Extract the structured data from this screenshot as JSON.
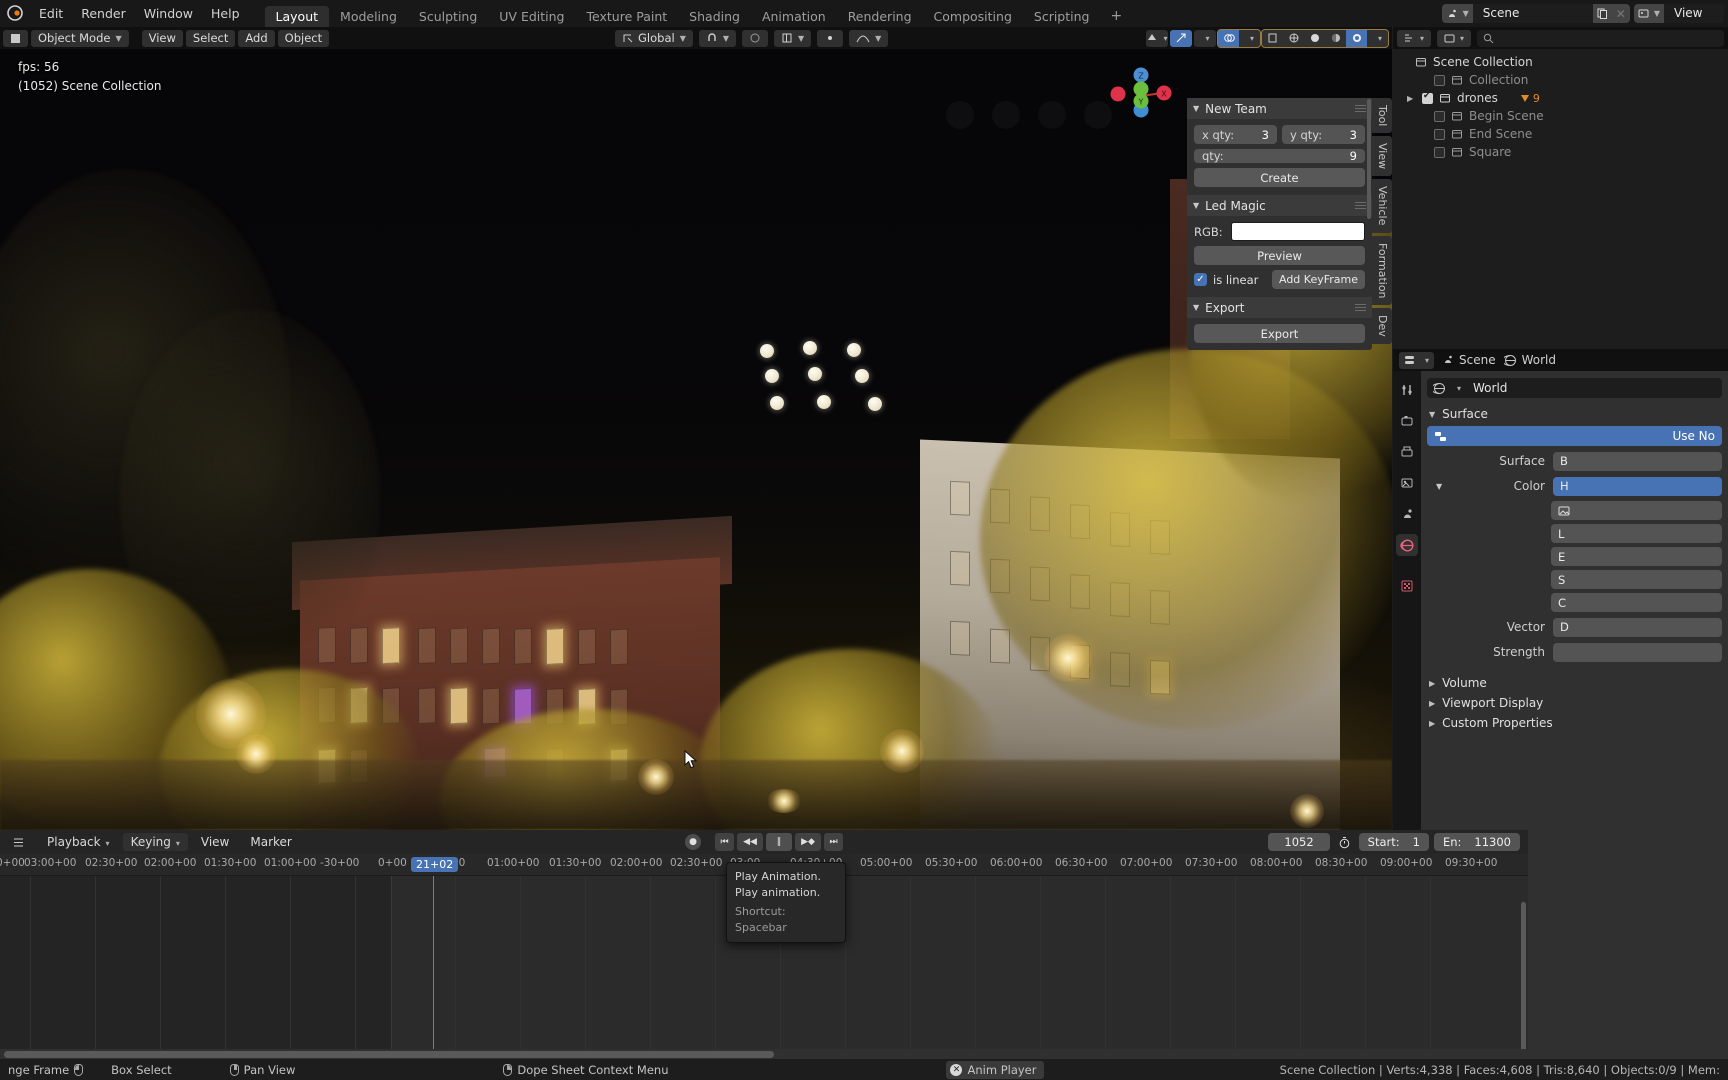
{
  "app": {
    "title": "Blender",
    "menus": [
      "Edit",
      "Render",
      "Window",
      "Help"
    ],
    "workspaces": [
      {
        "label": "Layout",
        "active": true
      },
      {
        "label": "Modeling",
        "active": false
      },
      {
        "label": "Sculpting",
        "active": false
      },
      {
        "label": "UV Editing",
        "active": false
      },
      {
        "label": "Texture Paint",
        "active": false
      },
      {
        "label": "Shading",
        "active": false
      },
      {
        "label": "Animation",
        "active": false
      },
      {
        "label": "Rendering",
        "active": false
      },
      {
        "label": "Compositing",
        "active": false
      },
      {
        "label": "Scripting",
        "active": false
      }
    ],
    "add_workspace_label": "+",
    "scene_name": "Scene",
    "view_layer_name": "View",
    "scene_icon": "scene-icon",
    "viewlayer_icon": "view-layer-icon",
    "new_scene_icon": "duplicate-icon",
    "remove_scene_icon": "close-icon"
  },
  "viewport_header": {
    "mode": "Object Mode",
    "menus": [
      "View",
      "Select",
      "Add",
      "Object"
    ],
    "transform_orientation": "Global",
    "snap_icon": "magnet-icon",
    "proportional_icon": "proportional-edit-icon",
    "falloff_icon": "falloff-curve-icon",
    "pivot_icon": "pivot-point-icon",
    "gizmo_icon": "gizmo-icon",
    "overlays_icon": "overlays-icon",
    "xray_icon": "xray-icon",
    "shading_wireframe_icon": "wireframe-icon",
    "shading_solid_icon": "solid-icon",
    "shading_material_icon": "material-preview-icon",
    "shading_rendered_icon": "rendered-icon"
  },
  "viewport": {
    "fps_text": "fps: 56",
    "collection_text": "(1052) Scene Collection",
    "gizmo_axes": [
      "Z",
      "Y",
      "X"
    ],
    "drone_count": 9,
    "drone_grid": {
      "cols": 3,
      "rows": 3
    }
  },
  "npanel": {
    "tabs": [
      "Tool",
      "View",
      "Vehicle",
      "Formation",
      "Dev"
    ],
    "active_tab": "Formation",
    "sections": [
      {
        "title": "New Team",
        "fields": [
          {
            "label": "x qty:",
            "value": "3"
          },
          {
            "label": "y qty:",
            "value": "3"
          },
          {
            "label": "qty:",
            "value": "9"
          }
        ],
        "button": "Create"
      },
      {
        "title": "Led Magic",
        "rgb_label": "RGB:",
        "rgb_color": "#ffffff",
        "preview_button": "Preview",
        "checkbox_label": "is linear",
        "checkbox_checked": true,
        "keyframe_button": "Add KeyFrame"
      },
      {
        "title": "Export",
        "button": "Export"
      }
    ]
  },
  "outliner": {
    "display_mode_icon": "outliner-display-mode-icon",
    "filter_icon": "filter-icon",
    "search_icon": "search-icon",
    "search_placeholder": "",
    "root": "Scene Collection",
    "items": [
      {
        "label": "Collection",
        "icon": "collection-icon",
        "checked": false,
        "dim": true,
        "expandable": false,
        "badge": ""
      },
      {
        "label": "drones",
        "icon": "collection-icon",
        "checked": true,
        "dim": false,
        "expandable": true,
        "badge": "9"
      },
      {
        "label": "Begin Scene",
        "icon": "collection-icon",
        "checked": false,
        "dim": true,
        "expandable": false,
        "badge": ""
      },
      {
        "label": "End Scene",
        "icon": "collection-icon",
        "checked": false,
        "dim": true,
        "expandable": false,
        "badge": ""
      },
      {
        "label": "Square",
        "icon": "collection-icon",
        "checked": false,
        "dim": true,
        "expandable": false,
        "badge": ""
      }
    ]
  },
  "properties": {
    "editor_icon": "properties-editor-icon",
    "breadcrumb": [
      {
        "label": "Scene",
        "icon": "scene-icon"
      },
      {
        "label": "World",
        "icon": "world-icon"
      }
    ],
    "tabs": [
      {
        "name": "tool-tab",
        "glyph": "⚙",
        "active": false
      },
      {
        "name": "render-tab",
        "glyph": "▣",
        "active": false
      },
      {
        "name": "output-tab",
        "glyph": "⎙",
        "active": false
      },
      {
        "name": "view-layer-tab",
        "glyph": "▦",
        "active": false
      },
      {
        "name": "scene-tab",
        "glyph": "◑",
        "active": false
      },
      {
        "name": "world-tab",
        "glyph": "●",
        "active": true
      },
      {
        "name": "texture-tab",
        "glyph": "░",
        "active": false
      }
    ],
    "id_name": "World",
    "surface_section": "Surface",
    "use_nodes_label": "Use No",
    "fields": [
      {
        "label": "Surface",
        "value": "B"
      },
      {
        "label": "Color",
        "value": "H"
      },
      {
        "label": "Vector",
        "value": "D"
      },
      {
        "label": "Strength",
        "value": ""
      }
    ],
    "sections": [
      "Volume",
      "Viewport Display",
      "Custom Properties"
    ]
  },
  "timeline": {
    "menus": [
      "Playback",
      "Keying",
      "View",
      "Marker"
    ],
    "transport": [
      {
        "name": "record-button",
        "glyph": "●"
      },
      {
        "name": "jump-to-start-button",
        "glyph": "⏮"
      },
      {
        "name": "previous-keyframe-button",
        "glyph": "◀◀"
      },
      {
        "name": "play-animation-button",
        "glyph": "‖"
      },
      {
        "name": "next-keyframe-button",
        "glyph": "▶◆"
      },
      {
        "name": "jump-to-end-button",
        "glyph": "⏭"
      }
    ],
    "current_frame": "1052",
    "autokey_icon": "stopwatch-icon",
    "start_label": "Start:",
    "start_value": "1",
    "end_label": "En:",
    "end_value": "11300",
    "playhead_label": "21+02",
    "ruler_ticks": [
      "0+00",
      "03:00+00",
      "02:30+00",
      "02:00+00",
      "01:30+00",
      "01:00+00",
      "-30+00",
      "0+00",
      "00",
      "01:00+00",
      "01:30+00",
      "02:00+00",
      "02:30+00",
      "03:00",
      "04:30+00",
      "05:00+00",
      "05:30+00",
      "06:00+00",
      "06:30+00",
      "07:00+00",
      "07:30+00",
      "08:00+00",
      "08:30+00",
      "09:00+00",
      "09:30+00"
    ]
  },
  "tooltip": {
    "title": "Play Animation.",
    "body": "Play animation.",
    "shortcut": "Shortcut: Spacebar"
  },
  "status_bar": {
    "items": [
      {
        "label": "nge Frame",
        "icon": "mouse-left-icon"
      },
      {
        "label": "Box Select",
        "icon": "mouse-left-icon"
      },
      {
        "label": "Pan View",
        "icon": "mouse-middle-icon"
      },
      {
        "label": "Dope Sheet Context Menu",
        "icon": "mouse-right-icon"
      }
    ],
    "anim_player": "Anim Player",
    "stats": "Scene Collection | Verts:4,338 | Faces:4,608 | Tris:8,640 | Objects:0/9 | Mem:"
  },
  "colors": {
    "accent_blue": "#4772b3",
    "panel_bg": "#303030",
    "editor_bg": "#1d1d1d",
    "header_bg": "#101010",
    "orange_badge": "#e08a2a"
  }
}
